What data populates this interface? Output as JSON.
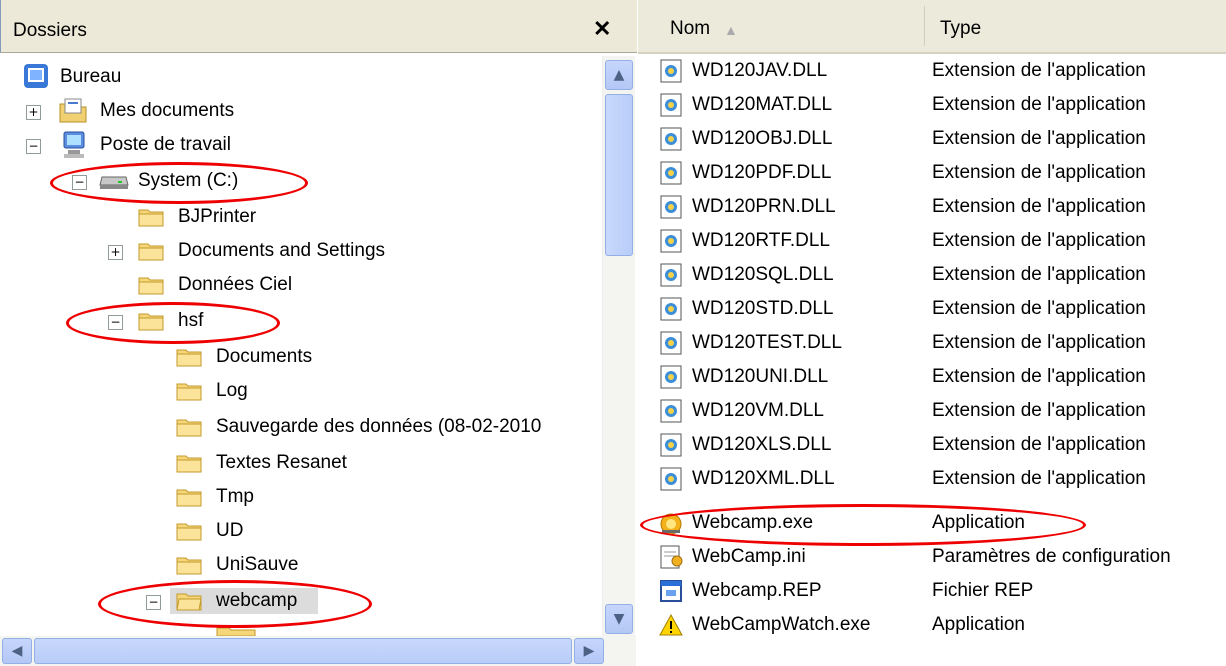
{
  "folders_panel": {
    "title": "Dossiers",
    "close_glyph": "✕",
    "tree": [
      {
        "label": "Bureau",
        "icon": "desktop-icon"
      },
      {
        "label": "Mes documents",
        "icon": "my-documents-icon",
        "expander": "+"
      },
      {
        "label": "Poste de travail",
        "icon": "my-computer-icon",
        "expander": "−"
      },
      {
        "label": "System (C:)",
        "icon": "drive-icon",
        "expander": "−"
      },
      {
        "label": "BJPrinter",
        "icon": "folder-icon"
      },
      {
        "label": "Documents and Settings",
        "icon": "folder-icon",
        "expander": "+"
      },
      {
        "label": "Données Ciel",
        "icon": "folder-icon"
      },
      {
        "label": "hsf",
        "icon": "folder-icon",
        "expander": "−"
      },
      {
        "label": "Documents",
        "icon": "folder-icon"
      },
      {
        "label": "Log",
        "icon": "folder-icon"
      },
      {
        "label": "Sauvegarde des données (08-02-2010",
        "icon": "folder-icon"
      },
      {
        "label": "Textes Resanet",
        "icon": "folder-icon"
      },
      {
        "label": "Tmp",
        "icon": "folder-icon"
      },
      {
        "label": "UD",
        "icon": "folder-icon"
      },
      {
        "label": "UniSauve",
        "icon": "folder-icon"
      },
      {
        "label": "webcamp",
        "icon": "folder-open-icon",
        "expander": "−"
      }
    ]
  },
  "file_list": {
    "columns": [
      "Nom",
      "Type"
    ],
    "sort_indicator": "▲",
    "rows": [
      {
        "name": "WD120JAV.DLL",
        "type": "Extension de l'application",
        "icon": "dll-icon"
      },
      {
        "name": "WD120MAT.DLL",
        "type": "Extension de l'application",
        "icon": "dll-icon"
      },
      {
        "name": "WD120OBJ.DLL",
        "type": "Extension de l'application",
        "icon": "dll-icon"
      },
      {
        "name": "WD120PDF.DLL",
        "type": "Extension de l'application",
        "icon": "dll-icon"
      },
      {
        "name": "WD120PRN.DLL",
        "type": "Extension de l'application",
        "icon": "dll-icon"
      },
      {
        "name": "WD120RTF.DLL",
        "type": "Extension de l'application",
        "icon": "dll-icon"
      },
      {
        "name": "WD120SQL.DLL",
        "type": "Extension de l'application",
        "icon": "dll-icon"
      },
      {
        "name": "WD120STD.DLL",
        "type": "Extension de l'application",
        "icon": "dll-icon"
      },
      {
        "name": "WD120TEST.DLL",
        "type": "Extension de l'application",
        "icon": "dll-icon"
      },
      {
        "name": "WD120UNI.DLL",
        "type": "Extension de l'application",
        "icon": "dll-icon"
      },
      {
        "name": "WD120VM.DLL",
        "type": "Extension de l'application",
        "icon": "dll-icon"
      },
      {
        "name": "WD120XLS.DLL",
        "type": "Extension de l'application",
        "icon": "dll-icon"
      },
      {
        "name": "WD120XML.DLL",
        "type": "Extension de l'application",
        "icon": "dll-icon"
      },
      {
        "name": "Webcamp.exe",
        "type": "Application",
        "icon": "webcamp-exe-icon"
      },
      {
        "name": "WebCamp.ini",
        "type": "Paramètres de configuration",
        "icon": "ini-settings-icon"
      },
      {
        "name": "Webcamp.REP",
        "type": "Fichier REP",
        "icon": "rep-file-icon"
      },
      {
        "name": "WebCampWatch.exe",
        "type": "Application",
        "icon": "warning-exe-icon"
      }
    ]
  },
  "colors": {
    "highlight_oval": "#e00000",
    "xp_scroll": "#b8cdf8"
  }
}
